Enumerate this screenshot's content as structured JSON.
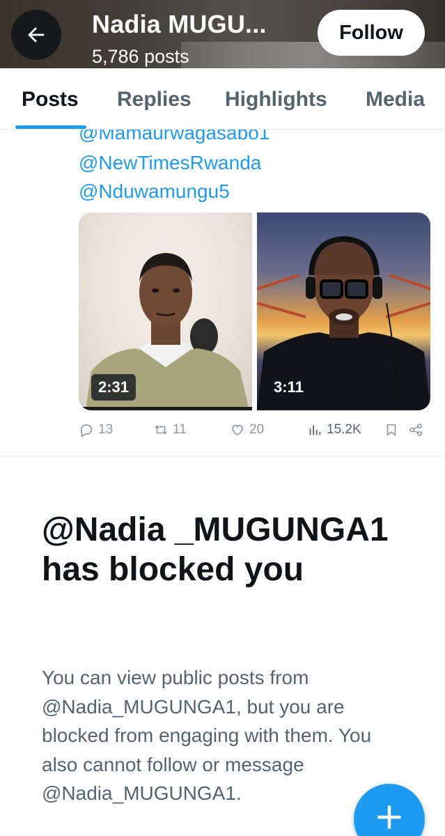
{
  "header": {
    "title": "Nadia MUGU...",
    "post_count": "5,786 posts",
    "back_icon": "arrow-left-icon",
    "follow_label": "Follow"
  },
  "tabs": [
    {
      "label": "Posts",
      "active": true
    },
    {
      "label": "Replies",
      "active": false
    },
    {
      "label": "Highlights",
      "active": false
    },
    {
      "label": "Media",
      "active": false
    }
  ],
  "post": {
    "mentions": [
      "@Mamaurwagasabo1",
      "@NewTimesRwanda",
      "@Nduwamungu5"
    ],
    "media": [
      {
        "duration": "2:31"
      },
      {
        "duration": "3:11"
      }
    ],
    "actions": {
      "replies": "13",
      "reposts": "11",
      "likes": "20",
      "views": "15.2K"
    }
  },
  "blocked": {
    "title": "@Nadia _MUGUNGA1 has blocked you",
    "body": "You can view public posts from @Nadia_MUGUNGA1, but you are blocked from engaging with them. You also cannot follow or message @Nadia_MUGUNGA1."
  },
  "fab": {
    "icon": "plus-icon"
  },
  "colors": {
    "accent": "#1d9bf0",
    "text_primary": "#0f1419",
    "text_secondary": "#536471"
  }
}
